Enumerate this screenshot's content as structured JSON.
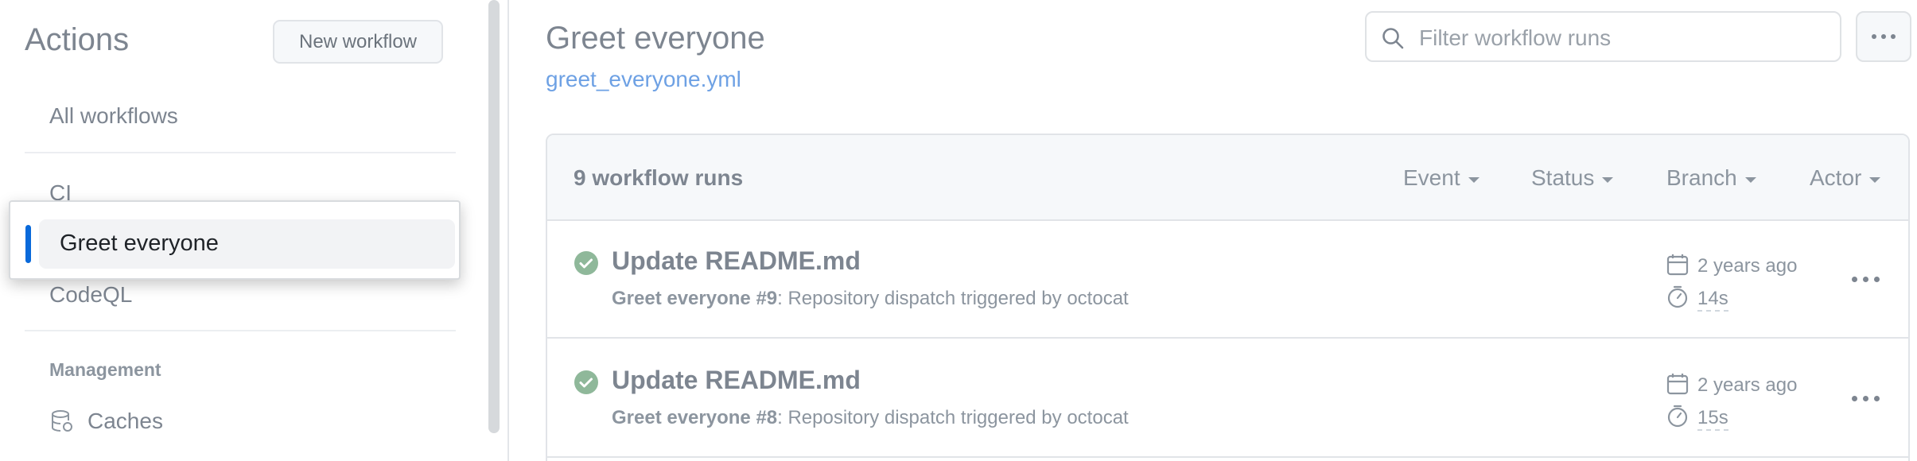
{
  "sidebar": {
    "title": "Actions",
    "new_workflow_label": "New workflow",
    "all_workflows": "All workflows",
    "workflows": [
      "CI",
      "Greet everyone",
      "CodeQL"
    ],
    "selected_workflow": "Greet everyone",
    "management_heading": "Management",
    "caches_label": "Caches"
  },
  "main": {
    "title": "Greet everyone",
    "workflow_file": "greet_everyone.yml",
    "filter_placeholder": "Filter workflow runs",
    "runs_count": "9 workflow runs",
    "filters": [
      "Event",
      "Status",
      "Branch",
      "Actor"
    ],
    "runs": [
      {
        "title": "Update README.md",
        "workflow": "Greet everyone",
        "number": "#9",
        "description": ": Repository dispatch triggered by octocat",
        "age": "2 years ago",
        "duration": "14s"
      },
      {
        "title": "Update README.md",
        "workflow": "Greet everyone",
        "number": "#8",
        "description": ": Repository dispatch triggered by octocat",
        "age": "2 years ago",
        "duration": "15s"
      }
    ]
  },
  "colors": {
    "accent_blue": "#0969da",
    "success_green": "#8fb89a",
    "link": "#6ea1e4"
  }
}
